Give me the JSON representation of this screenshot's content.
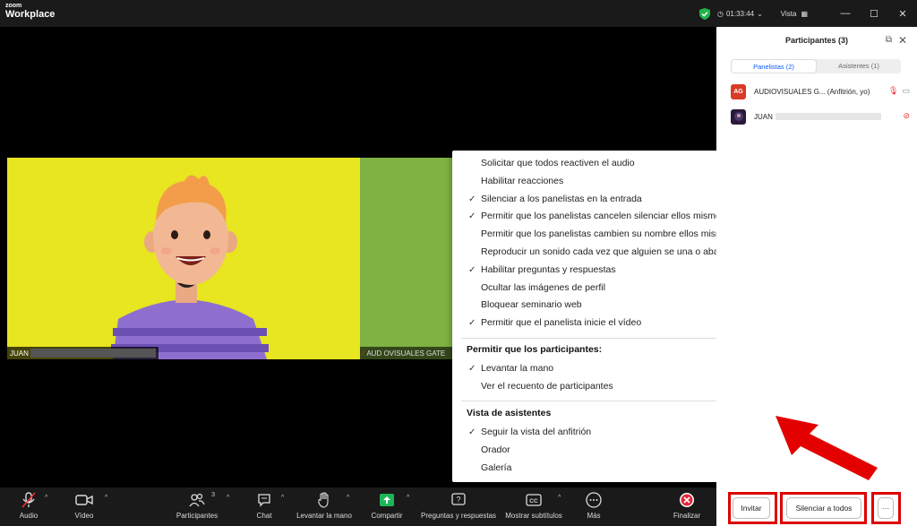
{
  "titlebar": {
    "logo_small": "zoom",
    "logo_big": "Workplace",
    "timer": "01:33:44",
    "view_label": "Vista"
  },
  "stage": {
    "tile1_name": "JUAN",
    "tile2_name": "AUD OVISUALES GATE"
  },
  "menu": {
    "items": [
      {
        "label": "Solicitar que todos reactiven el audio",
        "checked": false
      },
      {
        "label": "Habilitar reacciones",
        "checked": false
      },
      {
        "label": "Silenciar a los panelistas en la entrada",
        "checked": true
      },
      {
        "label": "Permitir que los panelistas cancelen silenciar ellos mismos",
        "checked": true
      },
      {
        "label": "Permitir que los panelistas cambien su nombre ellos mismos",
        "checked": false
      },
      {
        "label": "Reproducir un sonido cada vez que alguien se una o abandone",
        "checked": false
      },
      {
        "label": "Habilitar preguntas y respuestas",
        "checked": true
      },
      {
        "label": "Ocultar las imágenes de perfil",
        "checked": false
      },
      {
        "label": "Bloquear seminario web",
        "checked": false
      },
      {
        "label": "Permitir que el panelista inicie el vídeo",
        "checked": true
      }
    ],
    "section2_title": "Permitir que los participantes:",
    "section2_items": [
      {
        "label": "Levantar la mano",
        "checked": true
      },
      {
        "label": "Ver el recuento de participantes",
        "checked": false
      }
    ],
    "section3_title": "Vista de asistentes",
    "section3_items": [
      {
        "label": "Seguir la vista del anfitrión",
        "checked": true
      },
      {
        "label": "Orador",
        "checked": false
      },
      {
        "label": "Galería",
        "checked": false
      }
    ]
  },
  "panel": {
    "title": "Participantes (3)",
    "tab_panelists": "Panelistas (2)",
    "tab_attendees": "Asistentes (1)",
    "participants": [
      {
        "initials": "AG",
        "name": "AUDIOVISUALES G... (Anfitrión, yo)",
        "avatar_color": "#d83b27"
      },
      {
        "initials": "",
        "name": "JUAN",
        "avatar_color": "#2b1a3a"
      }
    ],
    "invite_label": "Invitar",
    "mute_all_label": "Silenciar a todos",
    "more_label": "···"
  },
  "toolbar": {
    "audio": "Audio",
    "video": "Vídeo",
    "participants": "Participantes",
    "participants_count": "3",
    "chat": "Chat",
    "raise_hand": "Levantar la mano",
    "share": "Compartir",
    "qa": "Preguntas y respuestas",
    "captions": "Mostrar subtítulos",
    "more": "Más",
    "end": "Finalizar"
  },
  "colors": {
    "accent_blue": "#0b5cff",
    "share_green": "#1fb45a",
    "end_red": "#e0283c",
    "highlight_red": "#dd0000"
  }
}
